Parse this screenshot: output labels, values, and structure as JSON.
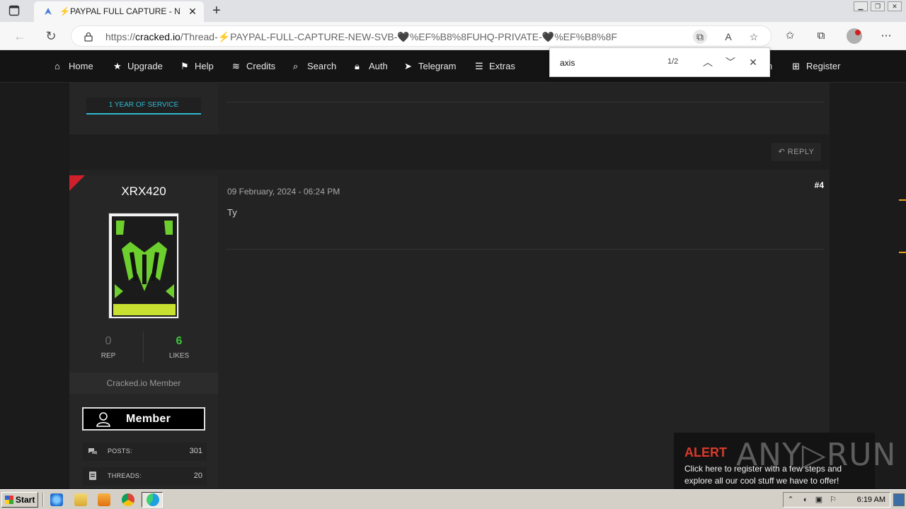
{
  "browser": {
    "tab_title": "⚡PAYPAL FULL CAPTURE - NEW S",
    "url_prefix": "https://",
    "url_host": "cracked.io",
    "url_path": "/Thread-⚡PAYPAL-FULL-CAPTURE-NEW-SVB-🖤%EF%B8%8FUHQ-PRIVATE-🖤%EF%B8%8F"
  },
  "find_bar": {
    "query": "axis",
    "count": "1/2"
  },
  "site_nav": {
    "items": [
      {
        "label": "Home",
        "icon": "home-icon"
      },
      {
        "label": "Upgrade",
        "icon": "star-icon"
      },
      {
        "label": "Help",
        "icon": "flag-icon"
      },
      {
        "label": "Credits",
        "icon": "coins-icon"
      },
      {
        "label": "Search",
        "icon": "search-icon"
      },
      {
        "label": "Auth",
        "icon": "lock-icon"
      },
      {
        "label": "Telegram",
        "icon": "telegram-icon"
      },
      {
        "label": "Extras",
        "icon": "menu-icon"
      }
    ],
    "partial_item": "n",
    "register": "Register"
  },
  "previous_post": {
    "badge": "1 YEAR OF SERVICE",
    "reply_label": "REPLY"
  },
  "post": {
    "username": "XRX420",
    "date": "09 February, 2024 - 06:24 PM",
    "number": "#4",
    "body": "Ty",
    "rep_value": "0",
    "rep_label": "REP",
    "likes_value": "6",
    "likes_label": "LIKES",
    "role": "Cracked.io Member",
    "member_badge": "Member",
    "posts_label": "POSTS:",
    "posts_value": "301",
    "threads_label": "THREADS:",
    "threads_value": "20"
  },
  "alert": {
    "title": "ALERT",
    "brand": "ANY▷RUN",
    "text": "Click here to register with a few steps and explore all our cool stuff we have to offer!"
  },
  "taskbar": {
    "start_label": "Start",
    "clock": "6:19 AM"
  },
  "colors": {
    "accent_cyan": "#2fb8d0",
    "likes_green": "#3cc83c",
    "alert_red": "#d93a2b",
    "corner_red": "#d0202b"
  }
}
